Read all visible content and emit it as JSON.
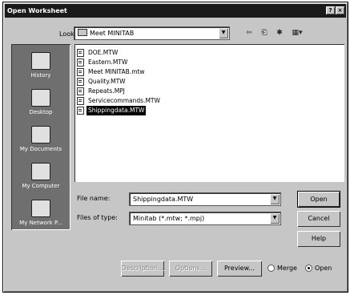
{
  "window": {
    "title": "Open Worksheet",
    "help_glyph": "?",
    "close_glyph": "×"
  },
  "lookin": {
    "label": "Look in:",
    "value": "Meet MINITAB",
    "arrow": "▼"
  },
  "toolbar_icons": [
    "back-icon",
    "up-folder-icon",
    "new-folder-icon",
    "view-menu-icon"
  ],
  "toolbar_glyphs": {
    "back": "⇦",
    "up": "⎗",
    "newfolder": "✱",
    "views": "▦▾"
  },
  "places": [
    {
      "label": "History",
      "icon": "history-icon"
    },
    {
      "label": "Desktop",
      "icon": "desktop-icon"
    },
    {
      "label": "My Documents",
      "icon": "my-documents-icon"
    },
    {
      "label": "My Computer",
      "icon": "my-computer-icon"
    },
    {
      "label": "My Network P...",
      "icon": "my-network-places-icon"
    }
  ],
  "files": [
    "DOE.MTW",
    "Eastern.MTW",
    "Meet MINITAB.mtw",
    "Quality.MTW",
    "Repeats.MPJ",
    "Servicecommands.MTW",
    "Shippingdata.MTW"
  ],
  "selected_file_index": 6,
  "filename": {
    "label": "File name:",
    "value": "Shippingdata.MTW"
  },
  "filetype": {
    "label": "Files of type:",
    "value": "Minitab (*.mtw; *.mpj)"
  },
  "buttons": {
    "open": "Open",
    "cancel": "Cancel",
    "help": "Help",
    "description": "Description...",
    "options": "Options...",
    "preview": "Preview..."
  },
  "radios": [
    {
      "label": "Merge",
      "checked": false
    },
    {
      "label": "Open",
      "checked": true
    }
  ]
}
